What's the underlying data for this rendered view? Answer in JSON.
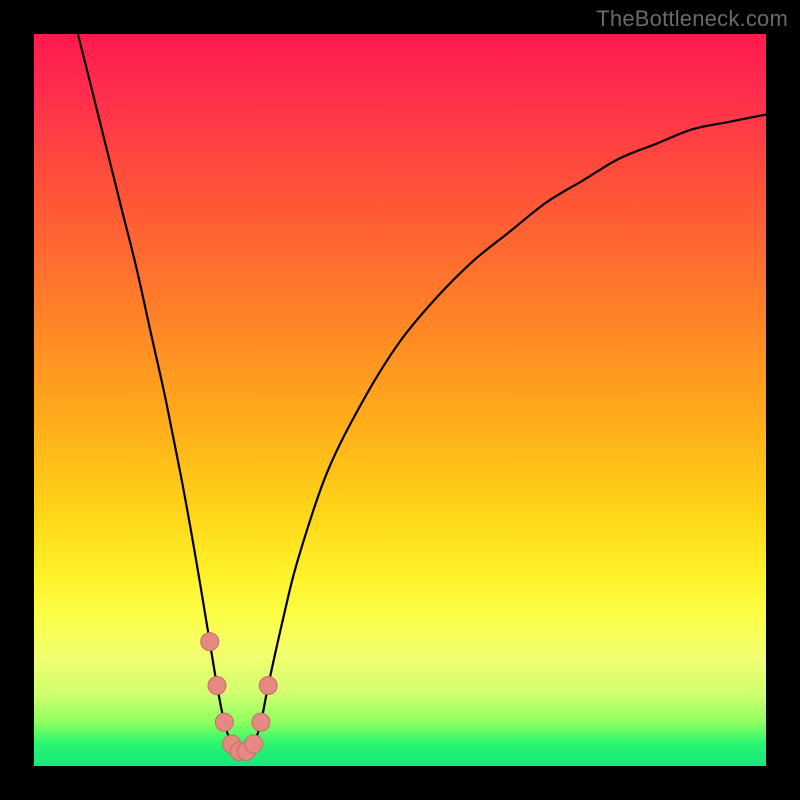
{
  "watermark": "TheBottleneck.com",
  "colors": {
    "frame": "#000000",
    "curve_stroke": "#000000",
    "marker_fill": "#e48a82",
    "marker_stroke": "#ce6a63",
    "gradient_top": "#ff1a4d",
    "gradient_bottom": "#17e87e"
  },
  "chart_data": {
    "type": "line",
    "title": "",
    "xlabel": "",
    "ylabel": "",
    "xlim": [
      0,
      100
    ],
    "ylim": [
      0,
      100
    ],
    "grid": false,
    "legend": false,
    "series": [
      {
        "name": "bottleneck-curve",
        "x": [
          6,
          8,
          10,
          12,
          14,
          16,
          18,
          20,
          22,
          24,
          25,
          26,
          27,
          28,
          29,
          30,
          31,
          32,
          34,
          36,
          40,
          45,
          50,
          55,
          60,
          65,
          70,
          75,
          80,
          85,
          90,
          95,
          100
        ],
        "values": [
          100,
          92,
          84,
          76,
          68,
          59,
          50,
          40,
          29,
          17,
          11,
          6,
          3,
          2,
          2,
          3,
          6,
          11,
          20,
          28,
          40,
          50,
          58,
          64,
          69,
          73,
          77,
          80,
          83,
          85,
          87,
          88,
          89
        ]
      }
    ],
    "markers": {
      "name": "highlighted-bottleneck-range",
      "x": [
        24,
        25,
        26,
        27,
        28,
        29,
        30,
        31,
        32
      ],
      "values": [
        17,
        11,
        6,
        3,
        2,
        2,
        3,
        6,
        11
      ]
    }
  }
}
